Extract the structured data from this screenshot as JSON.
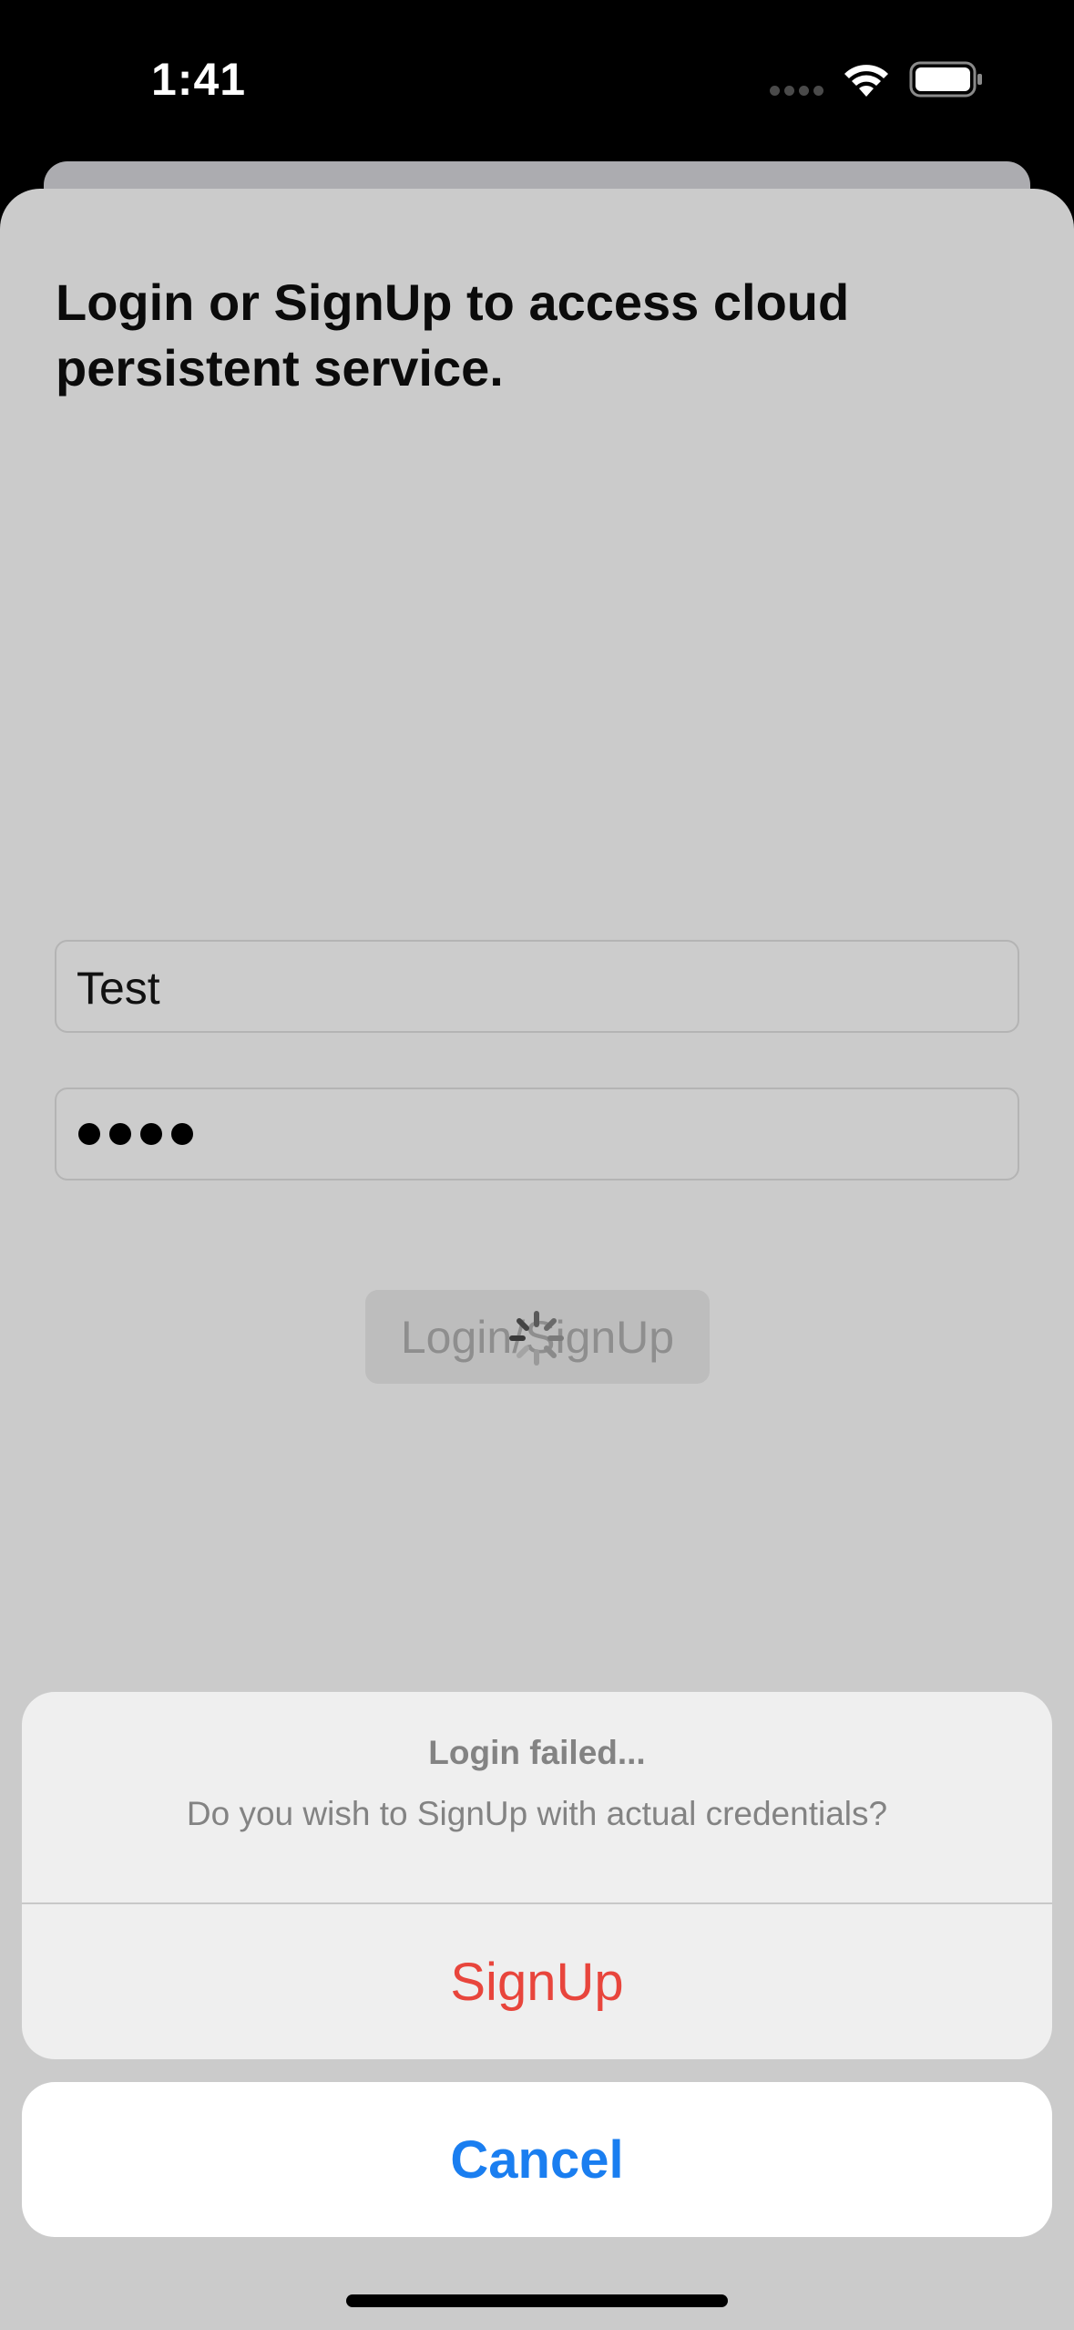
{
  "status_bar": {
    "time": "1:41",
    "icons": [
      "cellular-dots-icon",
      "wifi-icon",
      "battery-icon"
    ]
  },
  "login_sheet": {
    "headline": "Login or SignUp to access cloud persistent service.",
    "username": {
      "value": "Test"
    },
    "password": {
      "masked_length": 4
    },
    "button_label": "Login/SignUp",
    "button_state": "loading"
  },
  "alert": {
    "title": "Login failed...",
    "message": "Do you wish to SignUp with actual credentials?",
    "actions": [
      {
        "label": "SignUp",
        "style": "destructive"
      },
      {
        "label": "Cancel",
        "style": "cancel"
      }
    ]
  },
  "colors": {
    "sheet_background": "#cbcbcb",
    "destructive": "#e8453c",
    "cancel": "#1a7ef0"
  }
}
